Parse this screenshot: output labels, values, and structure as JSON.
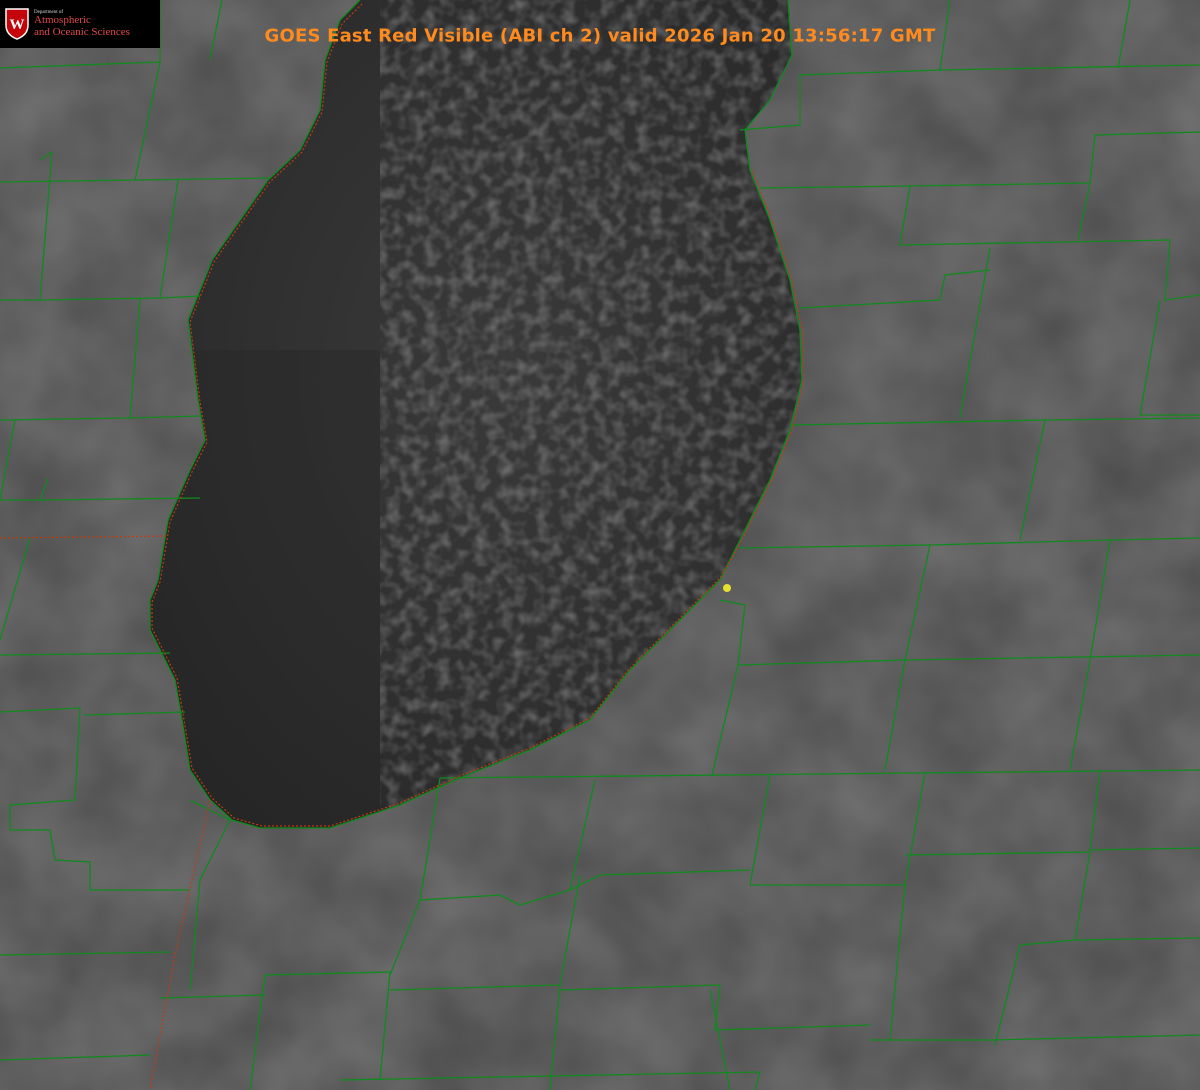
{
  "header": {
    "title": "GOES East Red Visible (ABI ch 2) valid 2026 Jan 20 13:56:17 GMT"
  },
  "logo": {
    "department": "Department of",
    "line1": "Atmospheric",
    "line2": "and Oceanic Sciences",
    "seal_letter": "W"
  },
  "map": {
    "colors": {
      "land": "#4a4a4a",
      "lake": "#2c2c2c",
      "county_border": "#0f8a1c",
      "state_border": "#c23a12",
      "marker": "#e6e030",
      "title": "#ff8a1e"
    },
    "marker_icon": "yellow-dot-icon"
  }
}
